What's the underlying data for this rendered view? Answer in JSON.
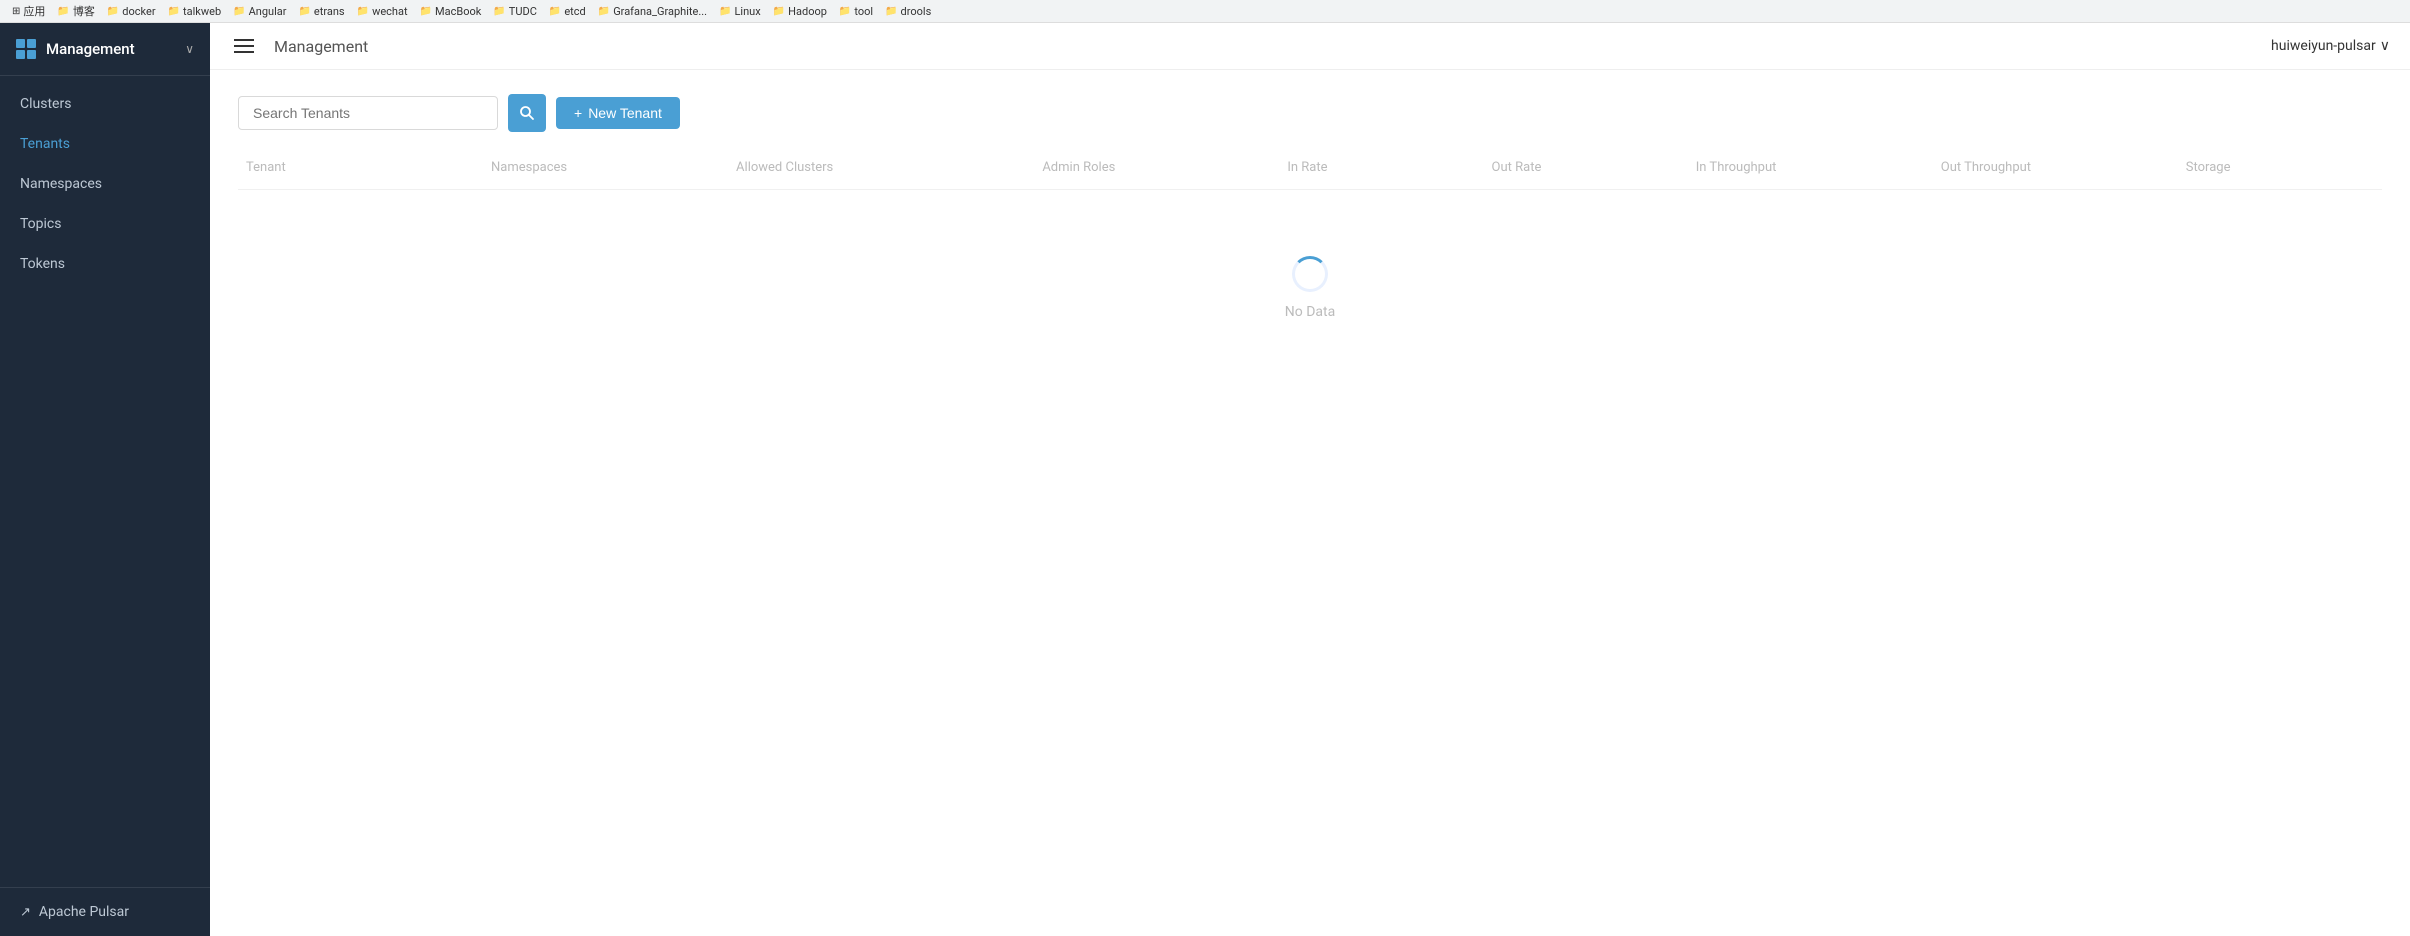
{
  "bookmarks": {
    "items": [
      {
        "label": "应用",
        "icon": "⊞"
      },
      {
        "label": "博客",
        "icon": "📁"
      },
      {
        "label": "docker",
        "icon": "📁"
      },
      {
        "label": "talkweb",
        "icon": "📁"
      },
      {
        "label": "Angular",
        "icon": "📁"
      },
      {
        "label": "etrans",
        "icon": "📁"
      },
      {
        "label": "wechat",
        "icon": "📁"
      },
      {
        "label": "MacBook",
        "icon": "📁"
      },
      {
        "label": "TUDC",
        "icon": "📁"
      },
      {
        "label": "etcd",
        "icon": "📁"
      },
      {
        "label": "Grafana_Graphite...",
        "icon": "📁"
      },
      {
        "label": "Linux",
        "icon": "📁"
      },
      {
        "label": "Hadoop",
        "icon": "📁"
      },
      {
        "label": "tool",
        "icon": "📁"
      },
      {
        "label": "drools",
        "icon": "📁"
      }
    ]
  },
  "sidebar": {
    "title": "Management",
    "logo_alt": "management-logo",
    "nav_items": [
      {
        "label": "Clusters",
        "active": false
      },
      {
        "label": "Tenants",
        "active": true
      },
      {
        "label": "Namespaces",
        "active": false
      },
      {
        "label": "Topics",
        "active": false
      },
      {
        "label": "Tokens",
        "active": false
      }
    ],
    "footer_link": "Apache Pulsar"
  },
  "header": {
    "title": "Management",
    "user": "huiweiyun-pulsar",
    "hamburger_label": "toggle-menu"
  },
  "toolbar": {
    "search_placeholder": "Search Tenants",
    "search_btn_label": "🔍",
    "new_tenant_label": "+ New Tenant"
  },
  "table": {
    "columns": [
      "Tenant",
      "Namespaces",
      "Allowed Clusters",
      "Admin Roles",
      "In Rate",
      "Out Rate",
      "In Throughput",
      "Out Throughput",
      "Storage"
    ]
  },
  "state": {
    "loading": true,
    "no_data_text": "No Data"
  },
  "colors": {
    "sidebar_bg": "#1e2a3a",
    "active_color": "#4a9fd4",
    "btn_color": "#4a9fd4"
  }
}
